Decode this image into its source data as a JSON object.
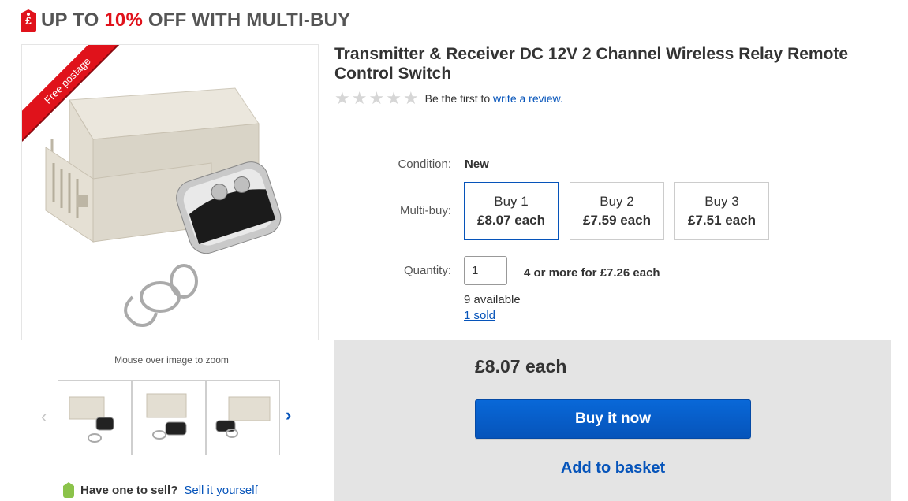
{
  "promo": {
    "icon": "price-tag-icon",
    "tag_glyph": "£",
    "prefix": "UP TO ",
    "percent": "10%",
    "suffix": " OFF WITH MULTI-BUY",
    "accent_color": "#e0121b"
  },
  "gallery": {
    "ribbon": "Free postage",
    "zoom_hint": "Mouse over image to zoom",
    "thumbnails_count": 3
  },
  "sell": {
    "question": "Have one to sell?",
    "link": "Sell it yourself"
  },
  "product": {
    "title": "Transmitter & Receiver DC 12V 2 Channel Wireless Relay Remote Control Switch",
    "rating_prefix": "Be the first to",
    "rating_link": "write a review.",
    "stars": 0,
    "stars_max": 5
  },
  "condition": {
    "label": "Condition:",
    "value": "New"
  },
  "multibuy": {
    "label": "Multi-buy:",
    "options": [
      {
        "qty": "Buy 1",
        "price": "£8.07 each",
        "selected": true
      },
      {
        "qty": "Buy 2",
        "price": "£7.59 each",
        "selected": false
      },
      {
        "qty": "Buy 3",
        "price": "£7.51 each",
        "selected": false
      }
    ]
  },
  "quantity": {
    "label": "Quantity:",
    "value": "1",
    "offer": "4 or more for £7.26 each",
    "available": "9 available",
    "sold": "1 sold"
  },
  "purchase": {
    "price": "£8.07 each",
    "buy_now": "Buy it now",
    "add_basket": "Add to basket",
    "brand_color": "#0654ba"
  }
}
